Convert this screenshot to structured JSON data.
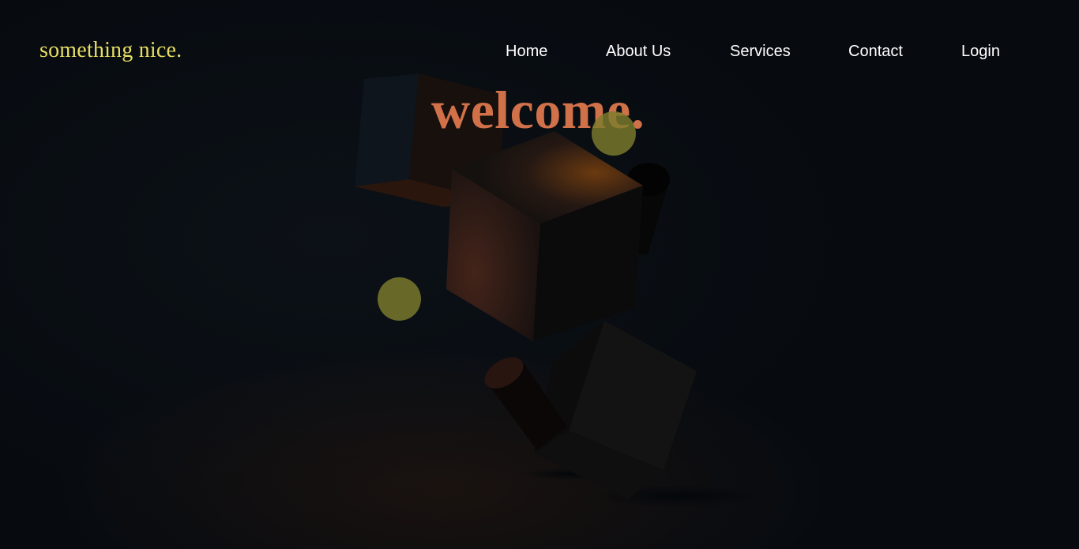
{
  "header": {
    "logo_text": "something nice."
  },
  "nav": {
    "items": [
      {
        "label": "Home"
      },
      {
        "label": "About Us"
      },
      {
        "label": "Services"
      },
      {
        "label": "Contact"
      },
      {
        "label": "Login"
      }
    ]
  },
  "hero": {
    "headline": "welcome."
  },
  "colors": {
    "background": "#070b10",
    "logo": "#e7df62",
    "nav_text": "#ffffff",
    "headline": "#d1714a",
    "orb": "#7d7d2d"
  }
}
